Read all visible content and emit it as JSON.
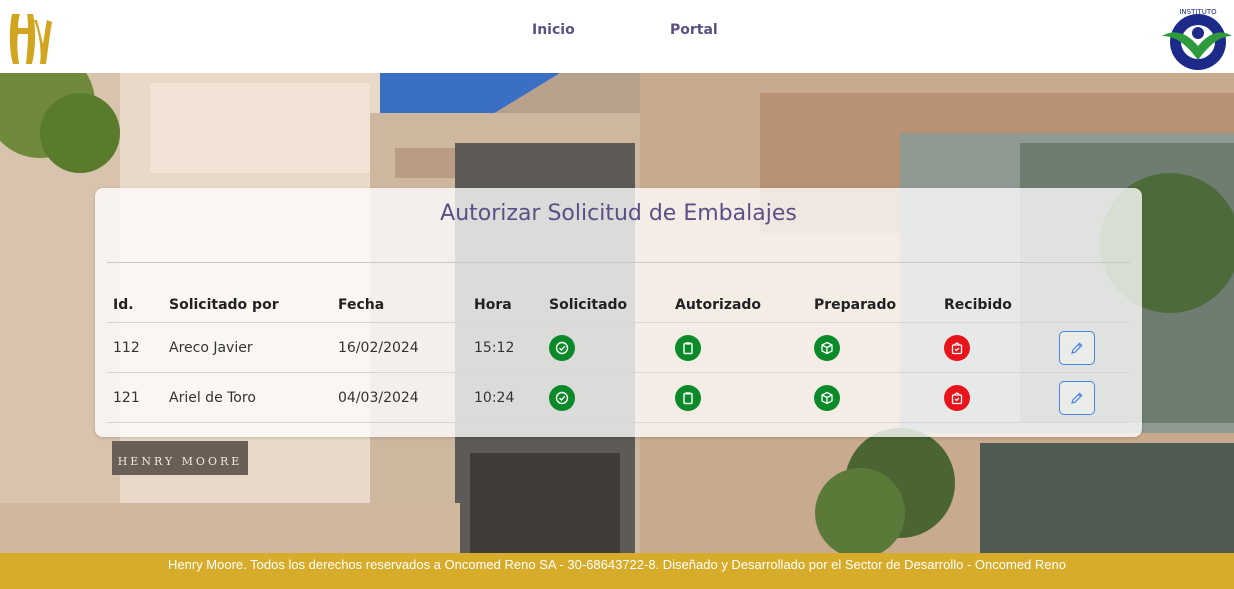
{
  "navbar": {
    "logo_text": "HM",
    "links": [
      {
        "label": "Inicio"
      },
      {
        "label": "Portal"
      }
    ],
    "institute_logo_text": "INSTITUTO"
  },
  "background": {
    "sign_text": "HENRY MOORE"
  },
  "card": {
    "title": "Autorizar Solicitud de Embalajes",
    "columns": [
      "Id.",
      "Solicitado por",
      "Fecha",
      "Hora",
      "Solicitado",
      "Autorizado",
      "Preparado",
      "Recibido",
      ""
    ],
    "rows": [
      {
        "id": "112",
        "solicitado_por": "Areco Javier",
        "fecha": "16/02/2024",
        "hora": "15:12",
        "solicitado": "check-circle-icon",
        "autorizado": "clipboard-icon",
        "preparado": "box-icon",
        "recibido": "bag-check-icon"
      },
      {
        "id": "121",
        "solicitado_por": "Ariel de Toro",
        "fecha": "04/03/2024",
        "hora": "10:24",
        "solicitado": "check-circle-icon",
        "autorizado": "clipboard-icon",
        "preparado": "box-icon",
        "recibido": "bag-check-icon"
      }
    ]
  },
  "colors": {
    "brand_purple": "#5b4f86",
    "status_done": "#0c8a2a",
    "status_pending": "#e8141c",
    "footer_gold": "#d8ac2b"
  },
  "footer": {
    "text": "Henry Moore. Todos los derechos reservados a Oncomed Reno SA - 30-68643722-8. Diseñado y Desarrollado por el Sector de Desarrollo - Oncomed Reno"
  }
}
